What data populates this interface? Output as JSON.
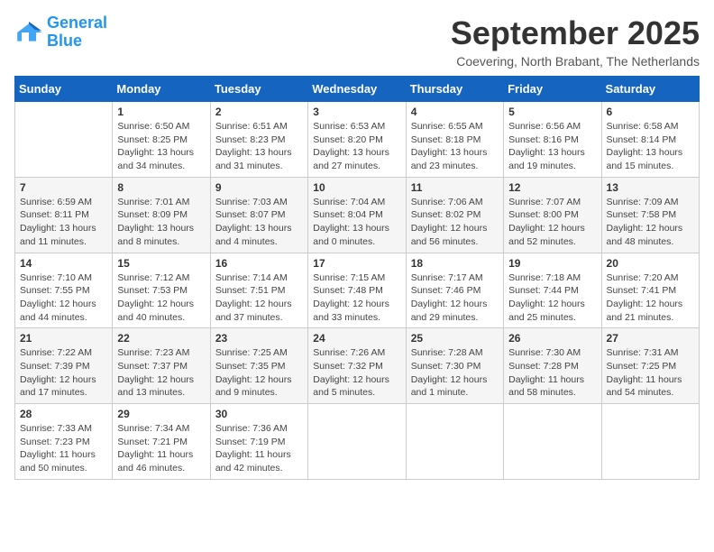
{
  "header": {
    "logo_line1": "General",
    "logo_line2": "Blue",
    "month_title": "September 2025",
    "location": "Coevering, North Brabant, The Netherlands"
  },
  "weekdays": [
    "Sunday",
    "Monday",
    "Tuesday",
    "Wednesday",
    "Thursday",
    "Friday",
    "Saturday"
  ],
  "weeks": [
    [
      {
        "day": "",
        "info": ""
      },
      {
        "day": "1",
        "info": "Sunrise: 6:50 AM\nSunset: 8:25 PM\nDaylight: 13 hours\nand 34 minutes."
      },
      {
        "day": "2",
        "info": "Sunrise: 6:51 AM\nSunset: 8:23 PM\nDaylight: 13 hours\nand 31 minutes."
      },
      {
        "day": "3",
        "info": "Sunrise: 6:53 AM\nSunset: 8:20 PM\nDaylight: 13 hours\nand 27 minutes."
      },
      {
        "day": "4",
        "info": "Sunrise: 6:55 AM\nSunset: 8:18 PM\nDaylight: 13 hours\nand 23 minutes."
      },
      {
        "day": "5",
        "info": "Sunrise: 6:56 AM\nSunset: 8:16 PM\nDaylight: 13 hours\nand 19 minutes."
      },
      {
        "day": "6",
        "info": "Sunrise: 6:58 AM\nSunset: 8:14 PM\nDaylight: 13 hours\nand 15 minutes."
      }
    ],
    [
      {
        "day": "7",
        "info": "Sunrise: 6:59 AM\nSunset: 8:11 PM\nDaylight: 13 hours\nand 11 minutes."
      },
      {
        "day": "8",
        "info": "Sunrise: 7:01 AM\nSunset: 8:09 PM\nDaylight: 13 hours\nand 8 minutes."
      },
      {
        "day": "9",
        "info": "Sunrise: 7:03 AM\nSunset: 8:07 PM\nDaylight: 13 hours\nand 4 minutes."
      },
      {
        "day": "10",
        "info": "Sunrise: 7:04 AM\nSunset: 8:04 PM\nDaylight: 13 hours\nand 0 minutes."
      },
      {
        "day": "11",
        "info": "Sunrise: 7:06 AM\nSunset: 8:02 PM\nDaylight: 12 hours\nand 56 minutes."
      },
      {
        "day": "12",
        "info": "Sunrise: 7:07 AM\nSunset: 8:00 PM\nDaylight: 12 hours\nand 52 minutes."
      },
      {
        "day": "13",
        "info": "Sunrise: 7:09 AM\nSunset: 7:58 PM\nDaylight: 12 hours\nand 48 minutes."
      }
    ],
    [
      {
        "day": "14",
        "info": "Sunrise: 7:10 AM\nSunset: 7:55 PM\nDaylight: 12 hours\nand 44 minutes."
      },
      {
        "day": "15",
        "info": "Sunrise: 7:12 AM\nSunset: 7:53 PM\nDaylight: 12 hours\nand 40 minutes."
      },
      {
        "day": "16",
        "info": "Sunrise: 7:14 AM\nSunset: 7:51 PM\nDaylight: 12 hours\nand 37 minutes."
      },
      {
        "day": "17",
        "info": "Sunrise: 7:15 AM\nSunset: 7:48 PM\nDaylight: 12 hours\nand 33 minutes."
      },
      {
        "day": "18",
        "info": "Sunrise: 7:17 AM\nSunset: 7:46 PM\nDaylight: 12 hours\nand 29 minutes."
      },
      {
        "day": "19",
        "info": "Sunrise: 7:18 AM\nSunset: 7:44 PM\nDaylight: 12 hours\nand 25 minutes."
      },
      {
        "day": "20",
        "info": "Sunrise: 7:20 AM\nSunset: 7:41 PM\nDaylight: 12 hours\nand 21 minutes."
      }
    ],
    [
      {
        "day": "21",
        "info": "Sunrise: 7:22 AM\nSunset: 7:39 PM\nDaylight: 12 hours\nand 17 minutes."
      },
      {
        "day": "22",
        "info": "Sunrise: 7:23 AM\nSunset: 7:37 PM\nDaylight: 12 hours\nand 13 minutes."
      },
      {
        "day": "23",
        "info": "Sunrise: 7:25 AM\nSunset: 7:35 PM\nDaylight: 12 hours\nand 9 minutes."
      },
      {
        "day": "24",
        "info": "Sunrise: 7:26 AM\nSunset: 7:32 PM\nDaylight: 12 hours\nand 5 minutes."
      },
      {
        "day": "25",
        "info": "Sunrise: 7:28 AM\nSunset: 7:30 PM\nDaylight: 12 hours\nand 1 minute."
      },
      {
        "day": "26",
        "info": "Sunrise: 7:30 AM\nSunset: 7:28 PM\nDaylight: 11 hours\nand 58 minutes."
      },
      {
        "day": "27",
        "info": "Sunrise: 7:31 AM\nSunset: 7:25 PM\nDaylight: 11 hours\nand 54 minutes."
      }
    ],
    [
      {
        "day": "28",
        "info": "Sunrise: 7:33 AM\nSunset: 7:23 PM\nDaylight: 11 hours\nand 50 minutes."
      },
      {
        "day": "29",
        "info": "Sunrise: 7:34 AM\nSunset: 7:21 PM\nDaylight: 11 hours\nand 46 minutes."
      },
      {
        "day": "30",
        "info": "Sunrise: 7:36 AM\nSunset: 7:19 PM\nDaylight: 11 hours\nand 42 minutes."
      },
      {
        "day": "",
        "info": ""
      },
      {
        "day": "",
        "info": ""
      },
      {
        "day": "",
        "info": ""
      },
      {
        "day": "",
        "info": ""
      }
    ]
  ]
}
